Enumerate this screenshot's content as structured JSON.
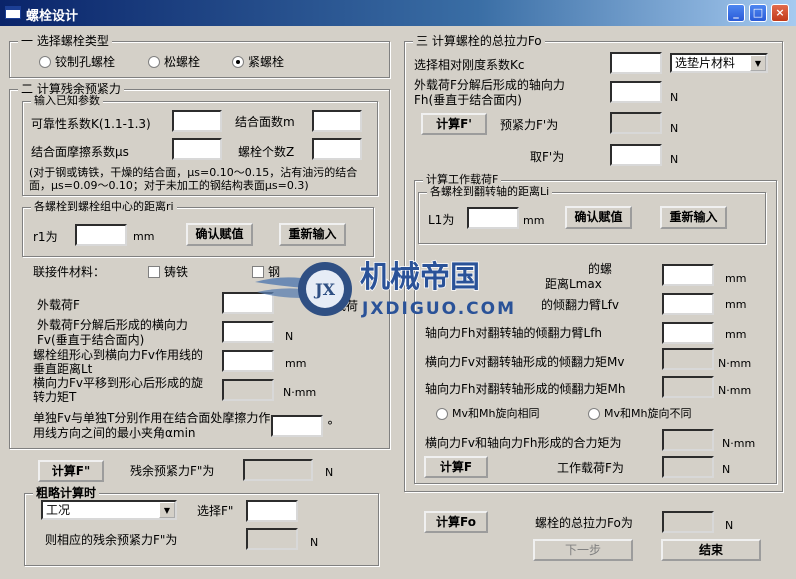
{
  "window": {
    "title": "螺栓设计"
  },
  "sec1": {
    "legend": "一 选择螺栓类型",
    "r1": "铰制孔螺栓",
    "r2": "松螺栓",
    "r3": "紧螺栓",
    "selected": "紧螺栓"
  },
  "sec2": {
    "legend": "二 计算残余预紧力",
    "known": "输入已知参数",
    "k_label": "可靠性系数K(1.1-1.3)",
    "m_label": "结合面数m",
    "mu_label": "结合面摩擦系数μs",
    "z_label": "螺栓个数Z",
    "note": "(对于钢或铸铁，干燥的结合面，μs=0.10～0.15，沾有油污的结合面，μs=0.09～0.10；对于未加工的钢结构表面μs=0.3)",
    "dist_legend": "各螺栓到螺栓组中心的距离ri",
    "r1_label": "r1为",
    "unit_mm": "mm",
    "confirm": "确认赋值",
    "reset": "重新输入",
    "material_label": "联接件材料：",
    "mat1": "铸铁",
    "mat2": "钢",
    "load_F": "外载荷F",
    "load_frag": "载荷",
    "fv_label": "外载荷F分解后形成的横向力Fv(垂直于结合面内)",
    "unit_N": "N",
    "lt_label": "螺栓组形心到横向力Fv作用线的垂直距离Lt",
    "T_label": "横向力Fv平移到形心后形成的旋转力矩T",
    "unit_Nmm": "N·mm",
    "alpha_label": "单独Fv与单独T分别作用在结合面处摩擦力作用线方向之间的最小夹角αmin",
    "unit_deg": "°",
    "calc_btn": "计算F\"",
    "residual_label": "残余预紧力F\"为"
  },
  "rough": {
    "legend": "粗略计算时",
    "combo": "工况",
    "select_label": "选择F\"",
    "result_label": "则相应的残余预紧力F\"为",
    "unit_N": "N"
  },
  "sec3": {
    "legend": "三 计算螺栓的总拉力Fo",
    "kc_label": "选择相对刚度系数Kc",
    "gasket_combo": "选垫片材料",
    "fh_label": "外载荷F分解后形成的轴向力Fh(垂直于结合面内)",
    "unit_N": "N",
    "calc_btn": "计算F'",
    "pre_label": "预紧力F'为",
    "take_label": "取F'为",
    "work_legend": "计算工作载荷F",
    "li_legend": "各螺栓到翻转轴的距离Li",
    "l1_label": "L1为",
    "unit_mm": "mm",
    "confirm": "确认赋值",
    "reset": "重新输入",
    "lmax_label_a": "的螺",
    "lmax_label_b": "距离Lmax",
    "lfv_label": "的倾翻力臂Lfv",
    "lfh_label": "轴向力Fh对翻转轴的倾翻力臂Lfh",
    "mv_label": "横向力Fv对翻转轴形成的倾翻力矩Mv",
    "mh_label": "轴向力Fh对翻转轴形成的倾翻力矩Mh",
    "unit_Nmm": "N·mm",
    "same_dir": "Mv和Mh旋向相同",
    "diff_dir": "Mv和Mh旋向不同",
    "combined_label": "横向力Fv和轴向力Fh形成的合力矩为",
    "calc_F_btn": "计算F",
    "work_load_label": "工作载荷F为"
  },
  "bottom": {
    "calc_fo_btn": "计算Fo",
    "total_label": "螺栓的总拉力Fo为",
    "unit_N": "N",
    "next_btn": "下一步",
    "end_btn": "结束"
  },
  "watermark": {
    "cn": "机械帝国",
    "en": "JXDIGUO.COM",
    "logo": "JX"
  }
}
